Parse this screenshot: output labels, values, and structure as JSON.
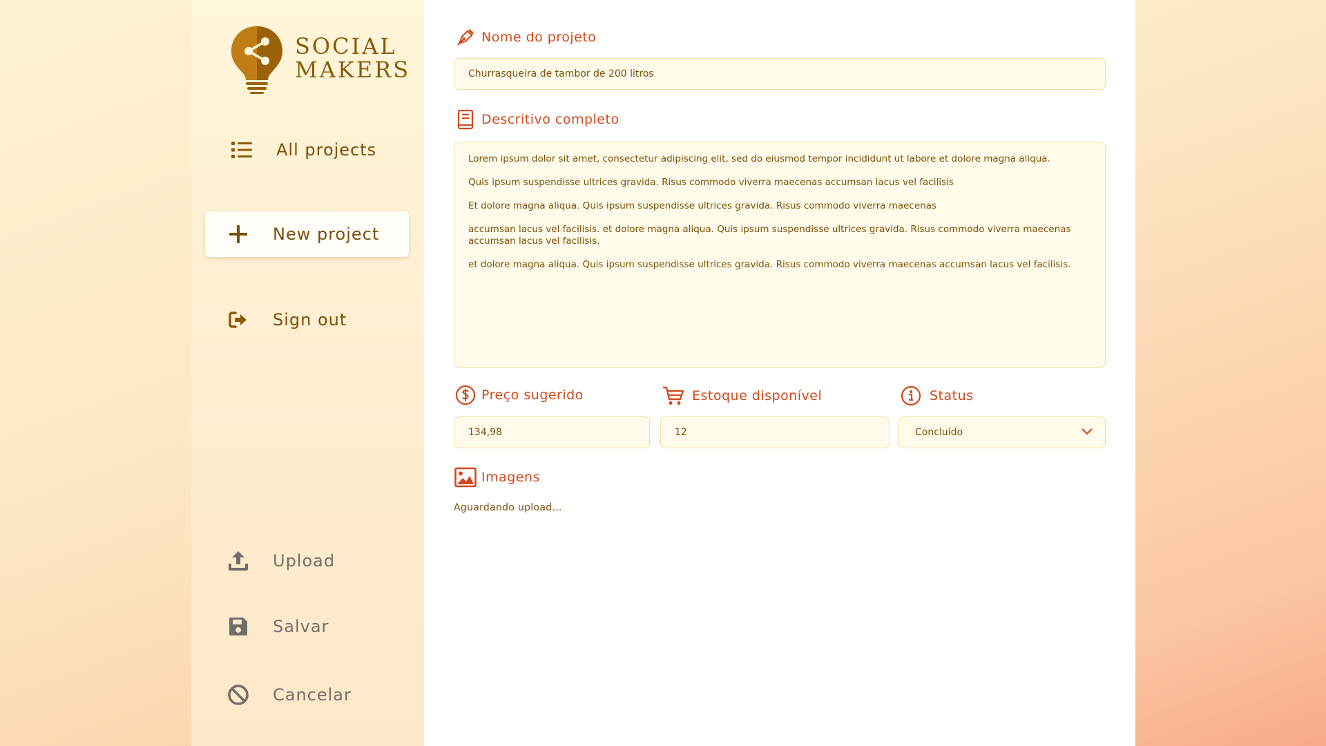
{
  "brand": {
    "line1": "SOCIAL",
    "line2": "MAKERS",
    "color": "#8a5a0b"
  },
  "sidebar": {
    "items": [
      {
        "label": "All projects",
        "icon": "list-icon"
      },
      {
        "label": "New project",
        "icon": "plus-icon",
        "active": true
      },
      {
        "label": "Sign out",
        "icon": "sign-out-icon"
      }
    ],
    "actions": [
      {
        "label": "Upload",
        "icon": "upload-icon"
      },
      {
        "label": "Salvar",
        "icon": "save-icon"
      },
      {
        "label": "Cancelar",
        "icon": "ban-icon"
      }
    ]
  },
  "form": {
    "name": {
      "label": "Nome do projeto",
      "value": "Churrasqueira de tambor de 200 litros",
      "icon": "pen-nib-icon"
    },
    "description": {
      "label": "Descritivo completo",
      "icon": "book-icon",
      "value": "Lorem ipsum dolor sit amet, consectetur adipiscing elit, sed do eiusmod tempor incididunt ut labore et dolore magna aliqua.\n\nQuis ipsum suspendisse ultrices gravida. Risus commodo viverra maecenas accumsan lacus vel facilisis\n\nEt dolore magna aliqua. Quis ipsum suspendisse ultrices gravida. Risus commodo viverra maecenas\n\naccumsan lacus vel facilisis. et dolore magna aliqua. Quis ipsum suspendisse ultrices gravida. Risus commodo viverra maecenas accumsan lacus vel facilisis.\n\net dolore magna aliqua. Quis ipsum suspendisse ultrices gravida. Risus commodo viverra maecenas accumsan lacus vel facilisis."
    },
    "price": {
      "label": "Preço sugerido",
      "value": "134,98",
      "icon": "dollar-circle-icon"
    },
    "stock": {
      "label": "Estoque disponível",
      "value": "12",
      "icon": "cart-icon"
    },
    "status": {
      "label": "Status",
      "value": "Concluído",
      "icon": "info-circle-icon"
    },
    "images": {
      "label": "Imagens",
      "status": "Aguardando upload...",
      "icon": "image-icon"
    }
  },
  "colors": {
    "accent": "#d4481b",
    "text": "#7a4f0a",
    "field_bg": "#fffbea",
    "field_border": "#f3de98",
    "muted": "#74716c"
  }
}
